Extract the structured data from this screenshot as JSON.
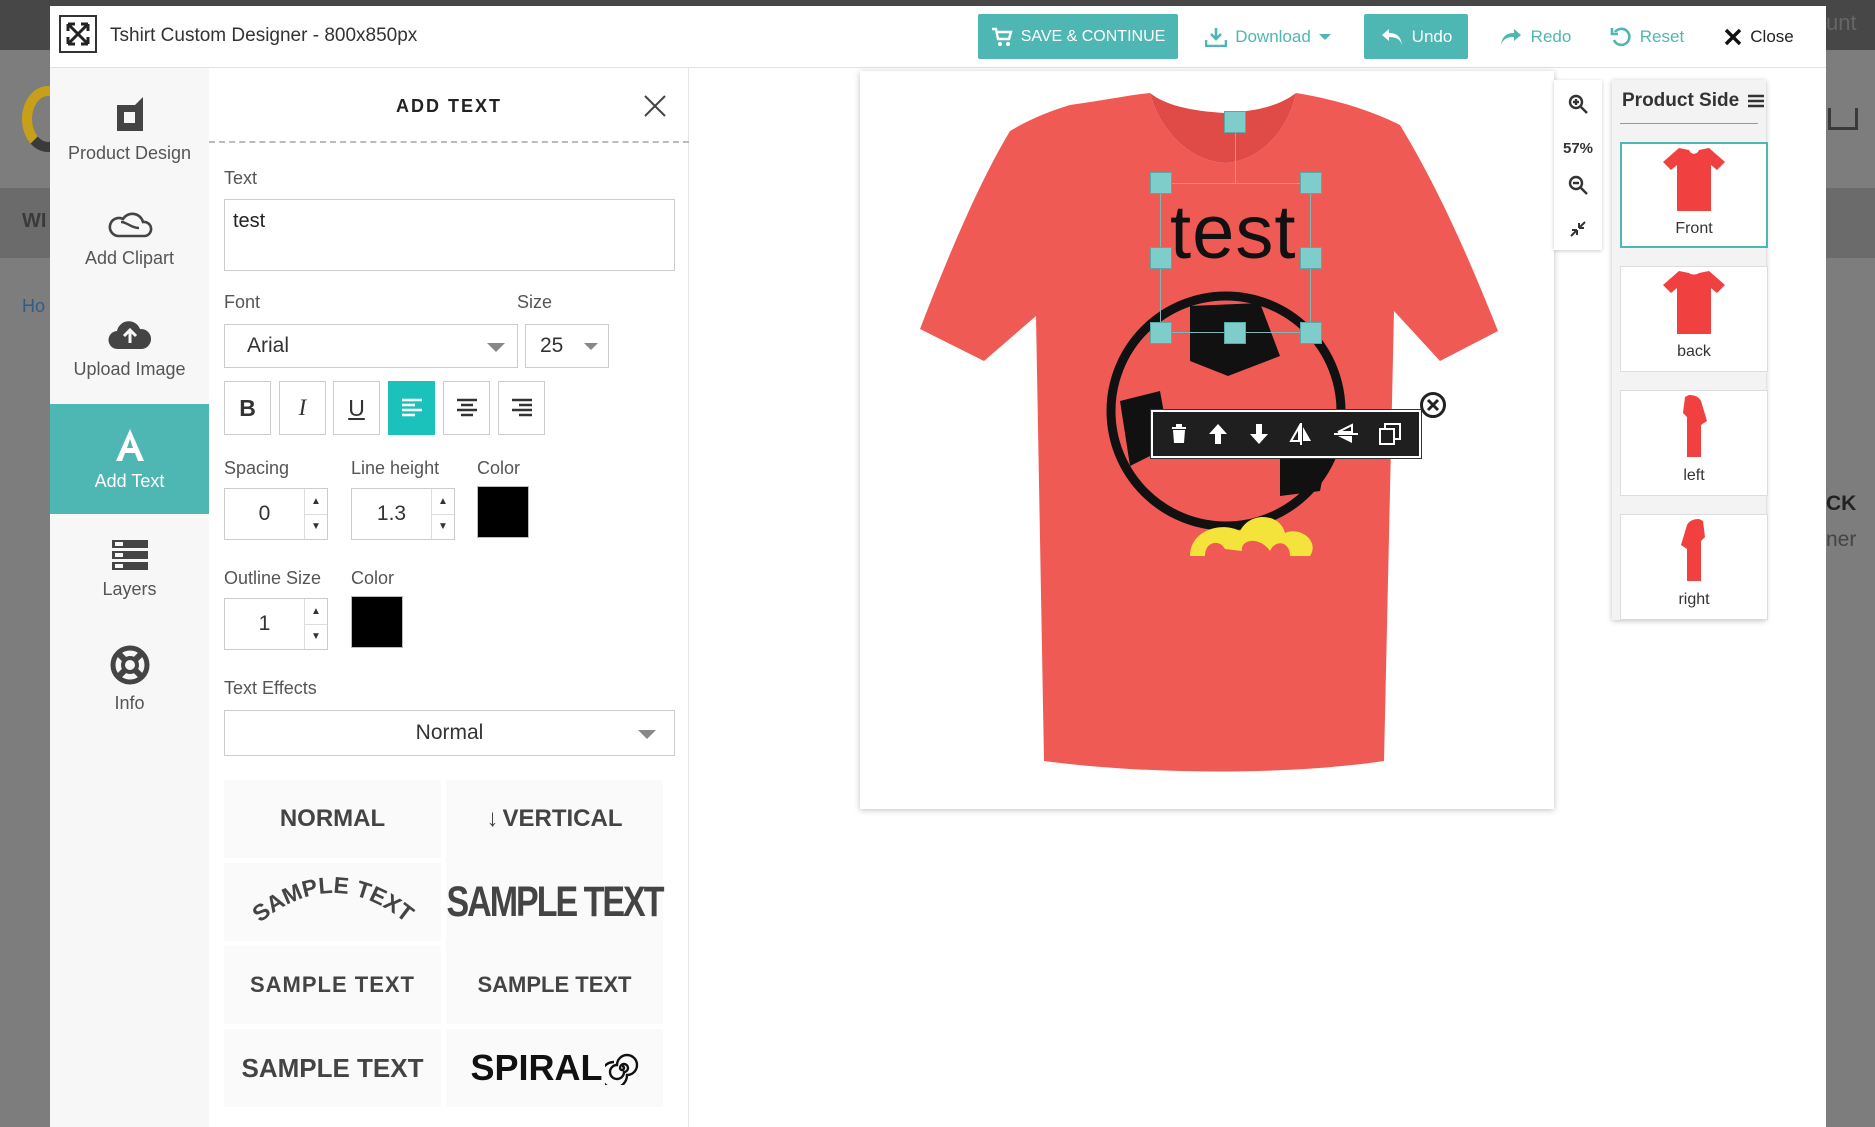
{
  "window": {
    "title": "Tshirt Custom Designer - 800x850px"
  },
  "topbar": {
    "save_label": "SAVE & CONTINUE",
    "download_label": "Download",
    "undo_label": "Undo",
    "redo_label": "Redo",
    "reset_label": "Reset",
    "close_label": "Close"
  },
  "leftnav": {
    "items": [
      {
        "label": "Product Design",
        "icon": "product-design-icon"
      },
      {
        "label": "Add Clipart",
        "icon": "clipart-icon"
      },
      {
        "label": "Upload Image",
        "icon": "upload-cloud-icon"
      },
      {
        "label": "Add Text",
        "icon": "text-icon"
      },
      {
        "label": "Layers",
        "icon": "layers-icon"
      },
      {
        "label": "Info",
        "icon": "lifebuoy-icon"
      }
    ],
    "active": "Add Text"
  },
  "panel": {
    "title": "ADD TEXT",
    "text_label": "Text",
    "text_value": "test",
    "font_label": "Font",
    "font_value": "Arial",
    "size_label": "Size",
    "size_value": "25",
    "format_buttons": [
      "B",
      "I",
      "U"
    ],
    "active_align": "left",
    "spacing_label": "Spacing",
    "spacing_value": "0",
    "line_height_label": "Line height",
    "line_height_value": "1.3",
    "color_label": "Color",
    "text_color": "#000000",
    "outline_size_label": "Outline Size",
    "outline_size_value": "1",
    "outline_color_label": "Color",
    "outline_color": "#000000",
    "effects_label": "Text Effects",
    "effects_value": "Normal",
    "effects": [
      "NORMAL",
      "VERTICAL",
      "SAMPLE TEXT",
      "SAMPLE TEXT",
      "SAMPLE TEXT",
      "SAMPLE TEXT",
      "SAMPLE TEXT",
      "SPIRAL"
    ]
  },
  "canvas": {
    "design_text": "test",
    "shirt_color": "#f05a55",
    "zoom_level": "57%"
  },
  "side": {
    "title": "Product Side",
    "items": [
      "Front",
      "back",
      "left",
      "right"
    ],
    "active": "Front"
  },
  "background": {
    "top_right_text": "unt",
    "left_text_1": "WI",
    "left_text_2": "Ho",
    "right_text_1": "CK",
    "right_text_2": "ner"
  },
  "colors": {
    "accent": "#4fb7b3",
    "active_format": "#1bc2bb"
  }
}
